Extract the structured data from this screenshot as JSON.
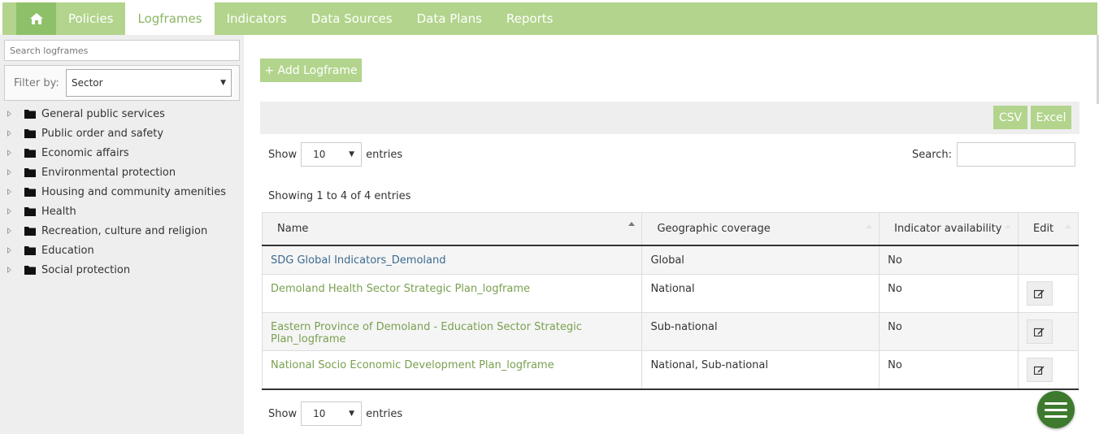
{
  "nav": {
    "home_icon": "home-icon",
    "tabs": [
      "Policies",
      "Logframes",
      "Indicators",
      "Data Sources",
      "Data Plans",
      "Reports"
    ],
    "active_tab": "Logframes"
  },
  "sidebar": {
    "search_placeholder": "Search logframes",
    "filter_label": "Filter by:",
    "filter_value": "Sector",
    "tree": [
      "General public services",
      "Public order and safety",
      "Economic affairs",
      "Environmental protection",
      "Housing and community amenities",
      "Health",
      "Recreation, culture and religion",
      "Education",
      "Social protection"
    ]
  },
  "main": {
    "add_button": "+ Add Logframe",
    "export": {
      "csv": "CSV",
      "excel": "Excel"
    },
    "length": {
      "show": "Show",
      "value": "10",
      "entries": "entries"
    },
    "search_label": "Search:",
    "info": "Showing 1 to 4 of 4 entries",
    "table": {
      "headers": [
        "Name",
        "Geographic coverage",
        "Indicator availability",
        "Edit"
      ],
      "rows": [
        {
          "name": "SDG Global Indicators_Demoland",
          "coverage": "Global",
          "availability": "No",
          "editable": false
        },
        {
          "name": "Demoland Health Sector Strategic Plan_logframe",
          "coverage": "National",
          "availability": "No",
          "editable": true
        },
        {
          "name": "Eastern Province of Demoland - Education Sector Strategic Plan_logframe",
          "coverage": "Sub-national",
          "availability": "No",
          "editable": true
        },
        {
          "name": "National Socio Economic Development Plan_logframe",
          "coverage": "National, Sub-national",
          "availability": "No",
          "editable": true
        }
      ]
    }
  },
  "colors": {
    "nav_bg": "#b2d48c",
    "home_bg": "#8ec06a",
    "accent_green": "#79a050",
    "link_blue": "#3d6b8f",
    "fab": "#3d7a2e"
  }
}
